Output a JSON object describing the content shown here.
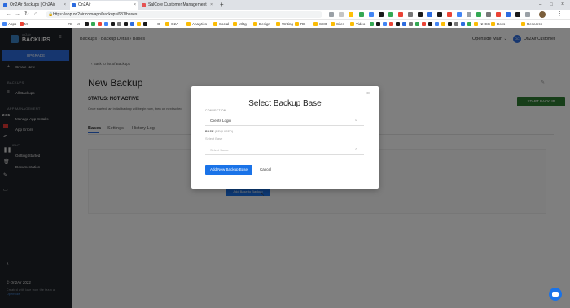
{
  "browser": {
    "tabs": [
      {
        "label": "On2Air Backups | On2Air",
        "color": "#2d6cdf",
        "active": false
      },
      {
        "label": "On2Air",
        "color": "#2d6cdf",
        "active": true
      },
      {
        "label": "SalCore Customer Management",
        "color": "#e55353",
        "active": false
      }
    ],
    "new_tab": "+",
    "url": "https://app.on2air.com/app/backups/637/bases",
    "bookmarks": [
      "Apps",
      "M",
      "#9",
      "M",
      "G",
      "O2A",
      "Analytics",
      "Social",
      "Mktg",
      "Design",
      "Writing",
      "RE",
      "SEO",
      "Sites",
      "Video",
      "NHCC",
      "Docs",
      "Research"
    ]
  },
  "sidebar": {
    "brand_top": "on2air",
    "brand": "BACKUPS",
    "upgrade": "UPGRADE",
    "create_new": "Create New",
    "section_backups": "BACKUPS",
    "all_backups": "All Backups",
    "section_app_management": "APP MANAGEMENT",
    "manage_app_installs": "Manage App Installs",
    "app_errors": "App Errors",
    "section_help": "HELP",
    "getting_started": "Getting Started",
    "documentation": "Documentation",
    "timer": "2:06",
    "copyright": "© On2Air 2022",
    "credits_line1": "Created with love from the team at",
    "credits_line2": "Openside"
  },
  "header": {
    "breadcrumb_1": "Backups",
    "breadcrumb_2": "Backup Detail",
    "breadcrumb_3": "Bases",
    "workspace": "Openside Main",
    "avatar_initials": "OC",
    "account": "On2Air Customer"
  },
  "page": {
    "back_link": "Back to list of Backups",
    "title": "New Backup",
    "status": "STATUS: NOT ACTIVE",
    "status_note": "Once started, an initial backup will begin now, then on next sched",
    "start_button": "START BACKUP",
    "tabs": [
      "Bases",
      "Settings",
      "History Log"
    ],
    "add_base_button": "Add Base to Backup"
  },
  "modal": {
    "title": "Select Backup Base",
    "connection_label": "CONNECTION",
    "connection_value": "Clients Login",
    "base_label": "BASE",
    "base_required": "(REQUIRED)",
    "base_sublabel": "Select Base",
    "base_placeholder": "Select Some",
    "primary_button": "Add New Backup Base",
    "cancel_button": "Cancel",
    "close": "×"
  },
  "colors": {
    "accent": "#1a73e8",
    "green": "#2e7d32",
    "sidebar_bg": "#1f2228",
    "upgrade": "#2d6cdf"
  }
}
